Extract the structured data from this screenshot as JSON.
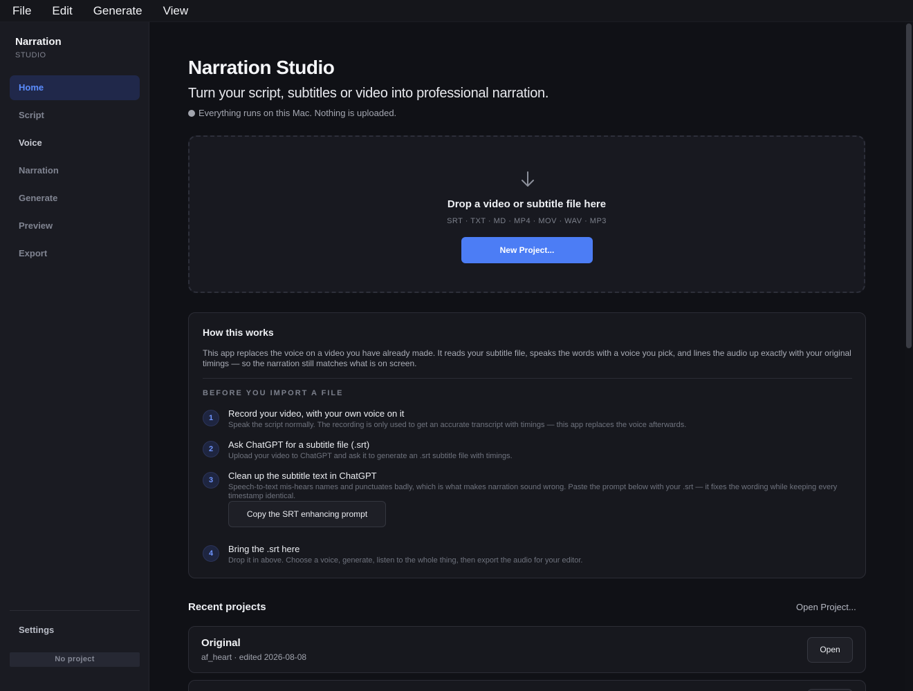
{
  "menubar": {
    "items": [
      "File",
      "Edit",
      "Generate",
      "View"
    ]
  },
  "sidebar": {
    "brand_title": "Narration",
    "brand_sub": "STUDIO",
    "items": [
      {
        "label": "Home",
        "active": true
      },
      {
        "label": "Script"
      },
      {
        "label": "Voice"
      },
      {
        "label": "Narration"
      },
      {
        "label": "Generate"
      },
      {
        "label": "Preview"
      },
      {
        "label": "Export"
      }
    ],
    "settings_label": "Settings",
    "project_status": "No project"
  },
  "main": {
    "title": "Narration Studio",
    "subtitle": "Turn your script, subtitles or video into professional narration.",
    "privacy_note": "Everything runs on this Mac. Nothing is uploaded.",
    "dropzone": {
      "icon": "arrow-down-icon",
      "title": "Drop a video or subtitle file here",
      "formats": "SRT · TXT · MD · MP4 · MOV · WAV · MP3",
      "button_label": "New Project..."
    },
    "how": {
      "title": "How this works",
      "description": "This app replaces the voice on a video you have already made. It reads your subtitle file, speaks the words with a voice you pick, and lines the audio up exactly with your original timings — so the narration still matches what is on screen.",
      "section_label": "BEFORE YOU IMPORT A FILE",
      "steps": [
        {
          "num": "1",
          "title": "Record your video, with your own voice on it",
          "desc": "Speak the script normally. The recording is only used to get an accurate transcript with timings — this app replaces the voice afterwards."
        },
        {
          "num": "2",
          "title": "Ask ChatGPT for a subtitle file (.srt)",
          "desc": "Upload your video to ChatGPT and ask it to generate an .srt subtitle file with timings."
        },
        {
          "num": "3",
          "title": "Clean up the subtitle text in ChatGPT",
          "desc": "Speech-to-text mis-hears names and punctuates badly, which is what makes narration sound wrong. Paste the prompt below with your .srt — it fixes the wording while keeping every timestamp identical.",
          "button_label": "Copy the SRT enhancing prompt"
        },
        {
          "num": "4",
          "title": "Bring the .srt here",
          "desc": "Drop it in above. Choose a voice, generate, listen to the whole thing, then export the audio for your editor."
        }
      ]
    },
    "recent": {
      "title": "Recent projects",
      "open_project_label": "Open Project...",
      "projects": [
        {
          "name": "Original",
          "meta": "af_heart · edited 2026-08-08",
          "open_label": "Open"
        }
      ]
    }
  }
}
